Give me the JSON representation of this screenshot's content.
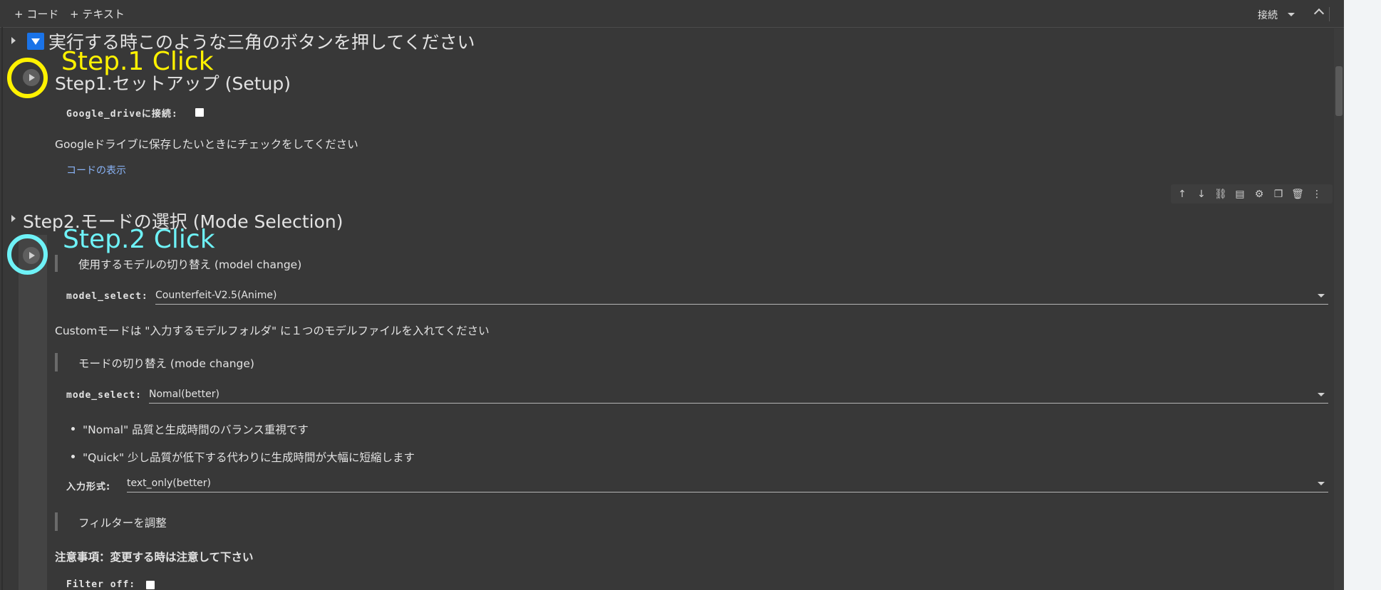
{
  "toolbar": {
    "add_code": "+ コード",
    "add_text": "+ テキスト",
    "connect": "接続"
  },
  "section_main": {
    "title": "実行する時このような三角のボタンを押してください"
  },
  "step1": {
    "annotation": "Step.1 Click",
    "annotation_color": "#fff200",
    "title": "Step1.セットアップ (Setup)",
    "drive_label": "Google_driveに接続:",
    "drive_desc": "Googleドライブに保存したいときにチェックをしてください",
    "show_code": "コードの表示"
  },
  "step2": {
    "annotation": "Step.2 Click",
    "annotation_color": "#6ef2f7",
    "title": "Step2.モードの選択 (Mode Selection)",
    "model_heading": "使用するモデルの切り替え (model change)",
    "model_label": "model_select:",
    "model_value": "Counterfeit-V2.5(Anime)",
    "custom_note": "Customモードは \"入力するモデルフォルダ\" に１つのモデルファイルを入れてください",
    "mode_heading": "モードの切り替え (mode change)",
    "mode_label": "mode_select:",
    "mode_value": "Nomal(better)",
    "bullets": [
      "\"Nomal\" 品質と生成時間のバランス重視です",
      "\"Quick\" 少し品質が低下する代わりに生成時間が大幅に短縮します"
    ],
    "input_label": "入力形式:",
    "input_value": "text_only(better)",
    "filter_heading": "フィルターを調整",
    "caution": "注意事項：変更する時は注意して下さい",
    "filter_label": "Filter off:"
  },
  "cell_toolbar": {
    "icons": [
      "arrow-up-icon",
      "arrow-down-icon",
      "link-icon",
      "comment-icon",
      "gear-icon",
      "copy-icon",
      "trash-icon",
      "more-icon"
    ]
  }
}
